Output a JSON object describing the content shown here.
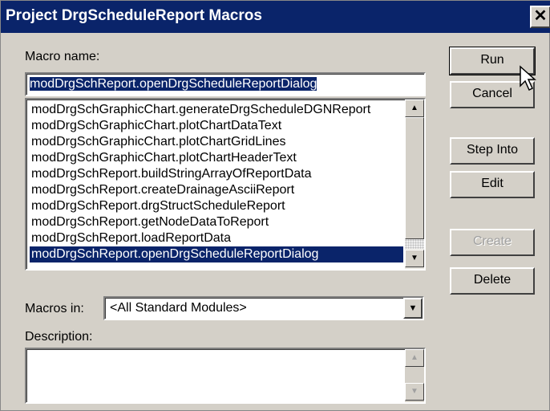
{
  "window": {
    "title": "Project DrgScheduleReport Macros",
    "close_glyph": "✕"
  },
  "macro_name": {
    "label": "Macro name:",
    "value": "modDrgSchReport.openDrgScheduleReportDialog"
  },
  "macro_list": {
    "items": [
      "modDrgSchGraphicChart.generateDrgScheduleDGNReport",
      "modDrgSchGraphicChart.plotChartDataText",
      "modDrgSchGraphicChart.plotChartGridLines",
      "modDrgSchGraphicChart.plotChartHeaderText",
      "modDrgSchReport.buildStringArrayOfReportData",
      "modDrgSchReport.createDrainageAsciiReport",
      "modDrgSchReport.drgStructScheduleReport",
      "modDrgSchReport.getNodeDataToReport",
      "modDrgSchReport.loadReportData",
      "modDrgSchReport.openDrgScheduleReportDialog"
    ],
    "selected_index": 9
  },
  "buttons": {
    "run": "Run",
    "cancel": "Cancel",
    "step_into": "Step Into",
    "edit": "Edit",
    "create": "Create",
    "delete": "Delete"
  },
  "macros_in": {
    "label": "Macros in:",
    "value": "<All Standard Modules>"
  },
  "description": {
    "label": "Description:",
    "value": ""
  },
  "icons": {
    "scroll_up": "up-arrow-icon",
    "scroll_down": "down-arrow-icon",
    "dropdown": "down-arrow-icon",
    "cursor": "mouse-pointer-icon"
  },
  "colors": {
    "title_bar": "#0a246a",
    "selection": "#0a246a",
    "face": "#d4d0c8"
  }
}
